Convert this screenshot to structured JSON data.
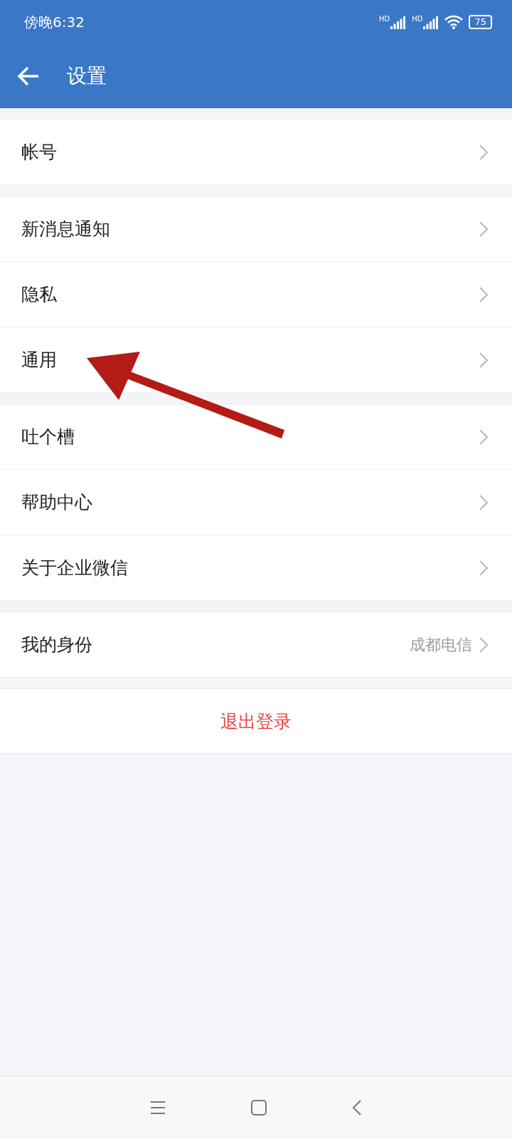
{
  "status_bar": {
    "time": "傍晚6:32",
    "signal_labels": [
      "HD",
      "HD"
    ],
    "battery": "75"
  },
  "header": {
    "title": "设置"
  },
  "groups": [
    {
      "items": [
        {
          "label": "帐号"
        }
      ]
    },
    {
      "items": [
        {
          "label": "新消息通知"
        },
        {
          "label": "隐私"
        },
        {
          "label": "通用"
        }
      ]
    },
    {
      "items": [
        {
          "label": "吐个槽"
        },
        {
          "label": "帮助中心"
        },
        {
          "label": "关于企业微信"
        }
      ]
    },
    {
      "items": [
        {
          "label": "我的身份",
          "value": "成都电信"
        }
      ]
    }
  ],
  "logout": {
    "label": "退出登录"
  }
}
